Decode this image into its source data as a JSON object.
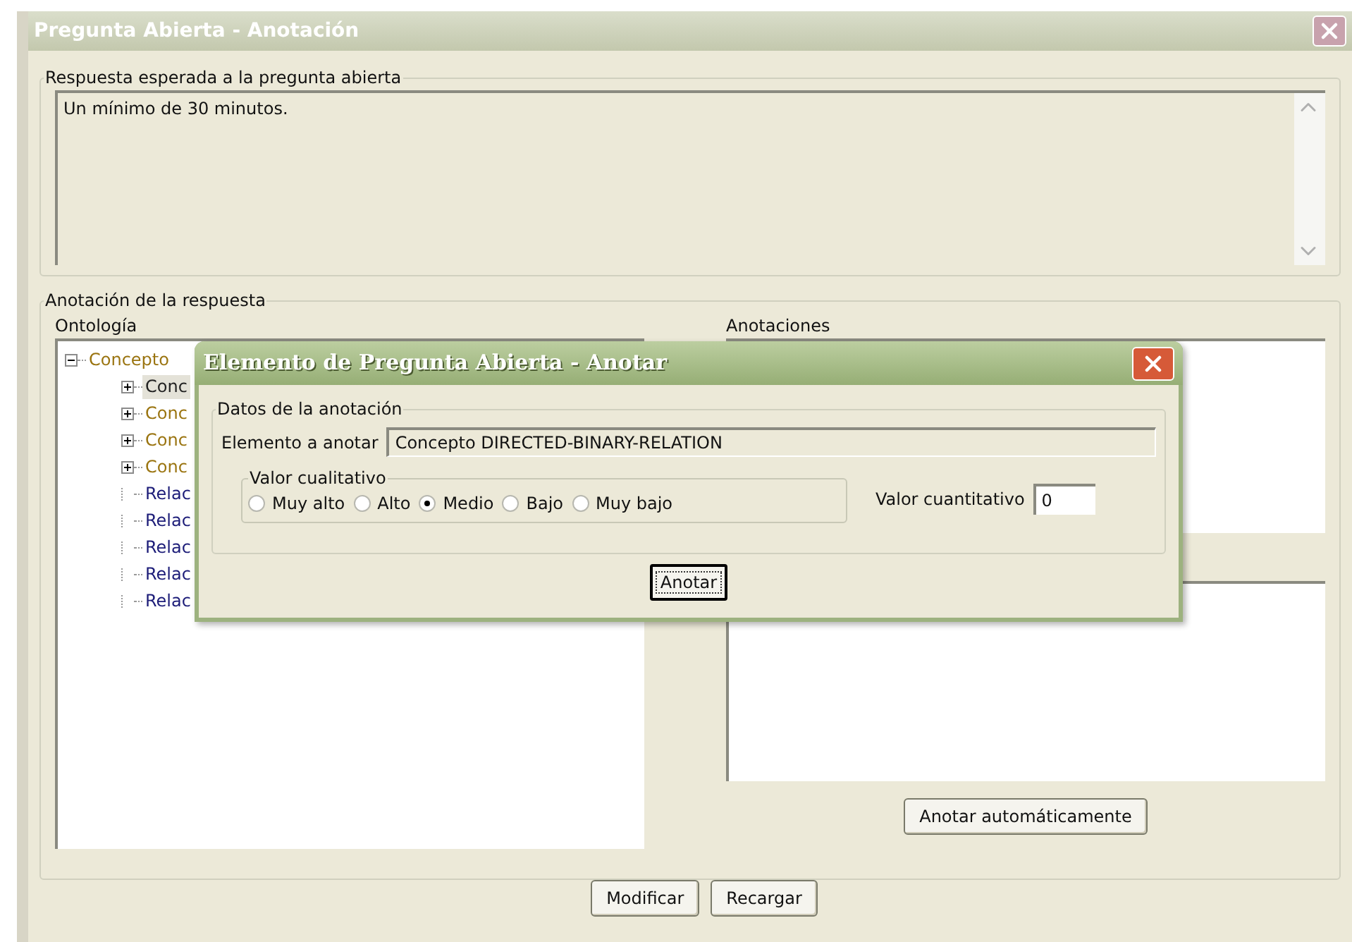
{
  "window": {
    "title": "Pregunta Abierta - Anotación"
  },
  "expected_answer": {
    "legend": "Respuesta esperada a la pregunta abierta",
    "text": "Un mínimo de 30 minutos."
  },
  "annotation": {
    "legend": "Anotación de la respuesta",
    "ontology_label": "Ontología",
    "annotations_label": "Anotaciones",
    "auto_button": "Anotar automáticamente",
    "tree": [
      {
        "label": "Concepto",
        "kind": "concept",
        "expanded": true,
        "selected": false,
        "children": [
          {
            "label": "Conc",
            "kind": "concept",
            "expanded": false,
            "selected": true
          },
          {
            "label": "Conc",
            "kind": "concept",
            "expanded": false,
            "selected": false
          },
          {
            "label": "Conc",
            "kind": "concept",
            "expanded": false,
            "selected": false
          },
          {
            "label": "Conc",
            "kind": "concept",
            "expanded": false,
            "selected": false
          },
          {
            "label": "Relac",
            "kind": "relation",
            "selected": false
          },
          {
            "label": "Relac",
            "kind": "relation",
            "selected": false
          },
          {
            "label": "Relac",
            "kind": "relation",
            "selected": false
          },
          {
            "label": "Relac",
            "kind": "relation",
            "selected": false
          },
          {
            "label": "Relac",
            "kind": "relation",
            "selected": false
          }
        ]
      }
    ]
  },
  "buttons": [
    "Modificar",
    "Recargar"
  ],
  "dialog": {
    "title": "Elemento de Pregunta Abierta - Anotar",
    "legend": "Datos de la anotación",
    "element_label": "Elemento a anotar",
    "element_value": "Concepto DIRECTED-BINARY-RELATION",
    "qualitative_legend": "Valor cualitativo",
    "options": [
      {
        "label": "Muy alto",
        "selected": false
      },
      {
        "label": "Alto",
        "selected": false
      },
      {
        "label": "Medio",
        "selected": true
      },
      {
        "label": "Bajo",
        "selected": false
      },
      {
        "label": "Muy bajo",
        "selected": false
      }
    ],
    "quantitative_label": "Valor cuantitativo",
    "quantitative_value": "0",
    "button": "Anotar"
  }
}
